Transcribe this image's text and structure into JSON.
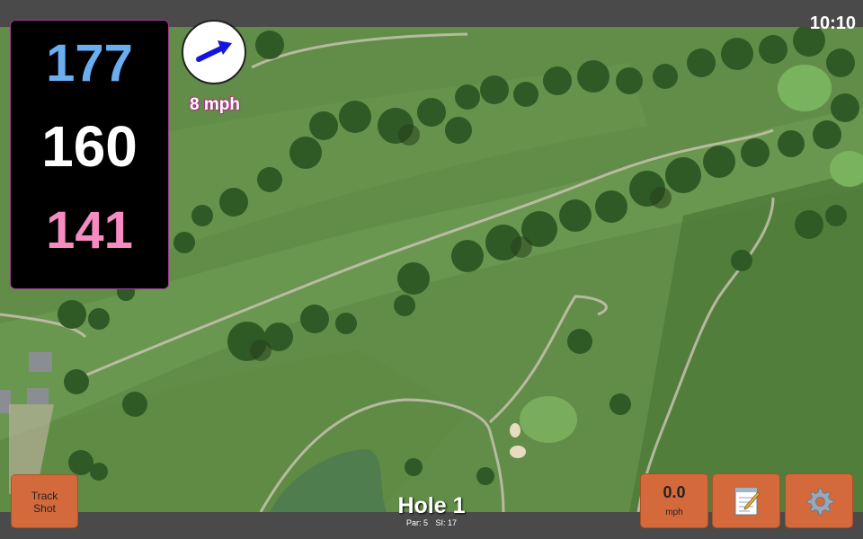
{
  "status": {
    "time": "10:10"
  },
  "distances": {
    "back": "177",
    "center": "160",
    "front": "141"
  },
  "wind": {
    "speed": "8 mph",
    "direction_icon": "arrow-icon"
  },
  "buttons": {
    "track_shot_line1": "Track",
    "track_shot_line2": "Shot",
    "speed_value": "0.0",
    "speed_unit": "mph",
    "notes_icon": "notepad-icon",
    "settings_icon": "gear-icon"
  },
  "hole": {
    "title": "Hole 1",
    "par": "Par: 5",
    "si": "SI: 17"
  },
  "colors": {
    "back_distance": "#6aaef0",
    "center_distance": "#ffffff",
    "front_distance": "#f58bc0",
    "button": "#d46a3c",
    "panel_border": "#9a3c8e",
    "wind_arrow": "#1414e0"
  }
}
